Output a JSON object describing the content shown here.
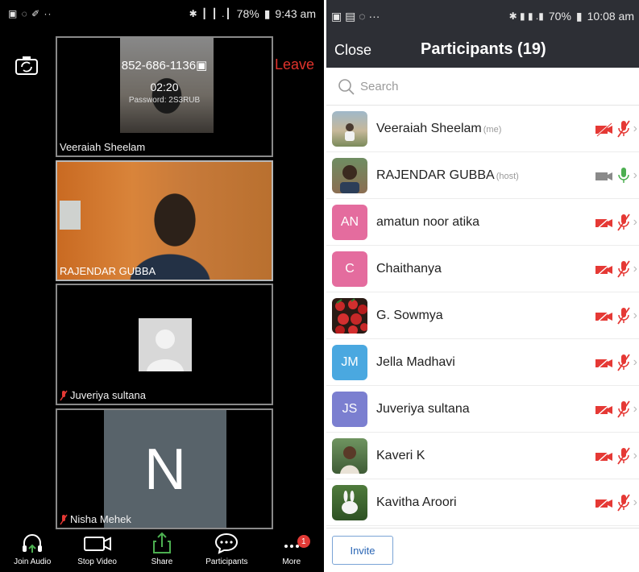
{
  "left": {
    "status_bar": {
      "left_icons": "▣ ◌ ✐ ··",
      "battery": "78%",
      "time": "9:43 am",
      "signal": "✱ ┃ ┃ .┃"
    },
    "meeting": {
      "phone": "852-686-1136",
      "timer": "02:20",
      "password": "Password: 2S3RUB",
      "leave_label": "Leave"
    },
    "tiles": [
      {
        "name": "Veeraiah Sheelam"
      },
      {
        "name": "RAJENDAR GUBBA"
      },
      {
        "name": "Juveriya sultana"
      },
      {
        "name": "Nisha Mehek",
        "initial": "N"
      }
    ],
    "toolbar": {
      "join_audio": "Join Audio",
      "stop_video": "Stop Video",
      "share": "Share",
      "participants": "Participants",
      "more": "More",
      "more_badge": "1"
    }
  },
  "right": {
    "status_bar": {
      "left_icons": "▣ ▤ ◌ ···",
      "battery": "70%",
      "time": "10:08 am"
    },
    "header": {
      "close_label": "Close",
      "title": "Participants (19)"
    },
    "search": {
      "placeholder": "Search"
    },
    "participants": [
      {
        "name": "Veeraiah Sheelam",
        "tag": "(me)",
        "avatar": "photo",
        "muted": true
      },
      {
        "name": "RAJENDAR GUBBA",
        "tag": "(host)",
        "avatar": "photo",
        "muted": false
      },
      {
        "name": "amatun noor atika",
        "tag": "",
        "initials": "AN",
        "muted": true
      },
      {
        "name": "Chaithanya",
        "tag": "",
        "initials": "C",
        "muted": true
      },
      {
        "name": "G. Sowmya",
        "tag": "",
        "avatar": "photo",
        "muted": true
      },
      {
        "name": "Jella Madhavi",
        "tag": "",
        "initials": "JM",
        "muted": true
      },
      {
        "name": "Juveriya sultana",
        "tag": "",
        "initials": "JS",
        "muted": true
      },
      {
        "name": "Kaveri K",
        "tag": "",
        "avatar": "photo",
        "muted": true
      },
      {
        "name": "Kavitha Aroori",
        "tag": "",
        "avatar": "photo",
        "muted": true
      }
    ],
    "invite_label": "Invite"
  },
  "colors": {
    "leave": "#e0332c",
    "muted_red": "#e53935",
    "mic_green": "#4caf50",
    "header_bg": "#2d2f35",
    "invite_blue": "#2a66b5"
  }
}
